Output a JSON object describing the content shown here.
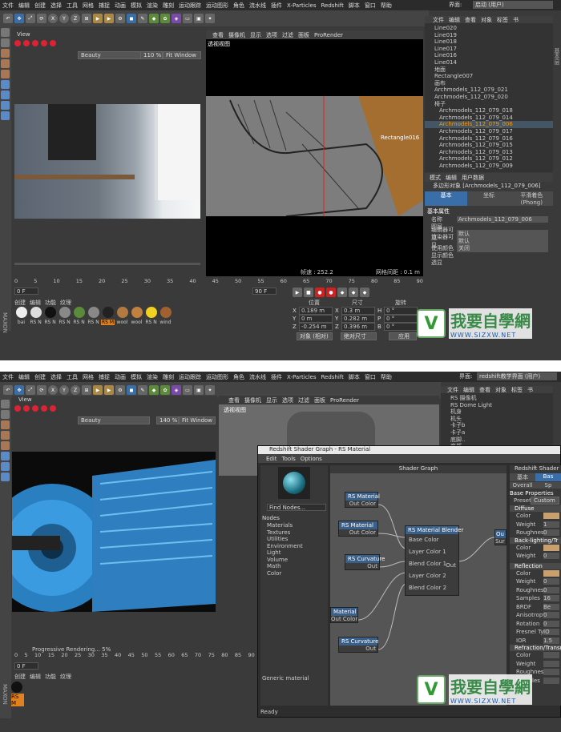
{
  "top": {
    "menu": [
      "文件",
      "编辑",
      "创建",
      "选择",
      "工具",
      "网格",
      "捕捉",
      "动画",
      "模拟",
      "渲染",
      "雕刻",
      "运动跟踪",
      "运动图形",
      "角色",
      "流水线",
      "插件",
      "X-Particles",
      "Redshift",
      "脚本",
      "窗口",
      "帮助"
    ],
    "layout_label": "界面:",
    "layout_value": "启动 (用户)",
    "view_title": "View",
    "render_mode": "Beauty",
    "zoom": "110 %",
    "fit": "Fit Window",
    "vp_menu": [
      "查看",
      "摄像机",
      "显示",
      "选项",
      "过滤",
      "面板",
      "ProRender"
    ],
    "vp_label": "透视视图",
    "vp_target": "Rectangle016",
    "vp_fps": "帧速 : 252.2",
    "vp_grid": "网格间距 : 0.1 m",
    "ruler": [
      "0",
      "5",
      "10",
      "15",
      "20",
      "25",
      "30",
      "35",
      "40",
      "45",
      "50",
      "55",
      "60",
      "65",
      "70",
      "75",
      "80",
      "85",
      "90"
    ],
    "frame_start": "0 F",
    "frame_end": "90 F",
    "frame_cur": "0",
    "mat_tabs": [
      "创建",
      "编辑",
      "功能",
      "纹理"
    ],
    "mats": [
      "bai",
      "RS N",
      "RS N",
      "RS N",
      "RS N",
      "RS N",
      "RS M",
      "wool",
      "wool",
      "RS N",
      "wind"
    ],
    "coord_headers": [
      "位置",
      "尺寸",
      "旋转"
    ],
    "coords": [
      [
        "X",
        "0.189 m",
        "X",
        "0.3 m",
        "H",
        "0 °"
      ],
      [
        "Y",
        "0 m",
        "Y",
        "0.282 m",
        "P",
        "0 °"
      ],
      [
        "Z",
        "-0.254 m",
        "Z",
        "0.396 m",
        "B",
        "0 °"
      ]
    ],
    "coord_mode": "对象 (相对)",
    "size_mode": "绝对尺寸",
    "apply": "应用",
    "obj_menu": [
      "文件",
      "编辑",
      "查看",
      "对象",
      "标签",
      "书"
    ],
    "objects": [
      "Line020",
      "Line019",
      "Line018",
      "Line017",
      "Line016",
      "Line014",
      "地面",
      "Rectangle007",
      "画布",
      "Archmodels_112_079_021",
      "Archmodels_112_079_020",
      "椅子",
      "Archmodels_112_079_018",
      "Archmodels_112_079_014",
      "Archmodels_112_079_006",
      "Archmodels_112_079_017",
      "Archmodels_112_079_016",
      "Archmodels_112_079_015",
      "Archmodels_112_079_013",
      "Archmodels_112_079_012",
      "Archmodels_112_079_009"
    ],
    "selected_object": "Archmodels_112_079_006",
    "attr_menu": [
      "模式",
      "编辑",
      "用户数据"
    ],
    "attr_title": "多边形对象 [Archmodels_112_079_006]",
    "attr_tabs": [
      "基本",
      "坐标",
      "平滑着色(Phong)"
    ],
    "attr_section": "基本属性",
    "attr_rows": [
      [
        "名称",
        "Archmodels_112_079_006"
      ],
      [
        "图层",
        ""
      ],
      [
        "编辑器可见",
        "默认"
      ],
      [
        "渲染器可见",
        "默认"
      ],
      [
        "使用颜色",
        "关闭"
      ],
      [
        "显示颜色",
        ""
      ],
      [
        "透显",
        ""
      ]
    ],
    "side_label": "基本层"
  },
  "bottom": {
    "menu": [
      "文件",
      "编辑",
      "创建",
      "选择",
      "工具",
      "网格",
      "捕捉",
      "动画",
      "模拟",
      "渲染",
      "雕刻",
      "运动跟踪",
      "运动图形",
      "角色",
      "流水线",
      "插件",
      "X-Particles",
      "Redshift",
      "脚本",
      "窗口",
      "帮助"
    ],
    "layout_label": "界面:",
    "layout_value": "redshift教学界面 (用户)",
    "view_title": "View",
    "render_mode": "Beauty",
    "zoom": "140 %",
    "fit": "Fit Window",
    "vp_menu": [
      "查看",
      "摄像机",
      "显示",
      "选项",
      "过滤",
      "面板",
      "ProRender"
    ],
    "vp_label": "透视视图",
    "progress": "Progressive Rendering... 5%",
    "obj_menu": [
      "文件",
      "编辑",
      "查看",
      "对象",
      "标签",
      "书"
    ],
    "objects": [
      "RS 摄像机",
      "RS Dome Light",
      "机身",
      "机头",
      "卡子b",
      "卡子a",
      "底脚..",
      "底部"
    ],
    "shader_title": "Redshift Shader Graph - RS Material",
    "shader_menu": [
      "Edit",
      "Tools",
      "Options"
    ],
    "find": "Find Nodes...",
    "graph_title": "Shader Graph",
    "nodes_head": "Nodes",
    "node_cats": [
      "Materials",
      "Textures",
      "Utilities",
      "Environment",
      "Light",
      "Volume",
      "Math",
      "Color"
    ],
    "generic": "Generic material",
    "ready": "Ready",
    "n1_title": "RS Material",
    "n1_out": "Out Color",
    "n2_title": "RS Material",
    "n2_out": "Out Color",
    "n3_title": "RS Curvature",
    "n3_out": "Out",
    "n4_title": "Material",
    "n4_out": "Out Color",
    "n5_title": "RS Curvature",
    "n5_out": "Out",
    "blender_title": "RS Material Blender",
    "blender_ports": [
      "Base Color",
      "Layer Color 1",
      "Blend Color 1",
      "Layer Color 2",
      "Blend Color 2"
    ],
    "blender_out": "Out",
    "out_node": "Ou",
    "out_port": "Sur",
    "props_title": "Redshift Shader N",
    "props_tabs": [
      "基本",
      "Bas"
    ],
    "props_tabs2": [
      "Overall",
      "Sp"
    ],
    "base_props": "Base Properties",
    "preset_label": "Preset",
    "preset_value": "Custom",
    "diffuse": "Diffuse",
    "diff_rows": [
      "Color",
      "Weight",
      "Roughness"
    ],
    "diff_vals": [
      "",
      "1",
      "0"
    ],
    "back": "Back-lighting/Tr",
    "back_rows": [
      "Color",
      "Weight"
    ],
    "back_vals": [
      "",
      "0"
    ],
    "reflection": "Reflection",
    "refl_rows": [
      "Color",
      "Weight",
      "Roughness",
      "Samples",
      "BRDF",
      "Anisotropy",
      "Rotation",
      "Fresnel Type",
      "IOR"
    ],
    "refl_vals": [
      "",
      "0",
      "0",
      "16",
      "Be",
      "0",
      "0",
      "IO",
      "1.5"
    ],
    "refraction": "Refraction/Transm",
    "refr_rows": [
      "Color",
      "Weight",
      "Roughness",
      "Samples"
    ],
    "mat_tabs": [
      "创建",
      "编辑",
      "功能",
      "纹理"
    ],
    "mat_name": "RS M",
    "ruler": [
      "0",
      "5",
      "10",
      "15",
      "20",
      "25",
      "30",
      "35",
      "40",
      "45",
      "50",
      "55",
      "60",
      "65",
      "70",
      "75",
      "80",
      "85",
      "90"
    ],
    "frame_start": "0 F"
  },
  "watermark": {
    "text": "我要自學網",
    "url": "WWW.SIZXW.NET"
  },
  "colors": {
    "accent": "#e08020",
    "panel": "#3a3a3a",
    "node_header": "#3a5f88"
  }
}
